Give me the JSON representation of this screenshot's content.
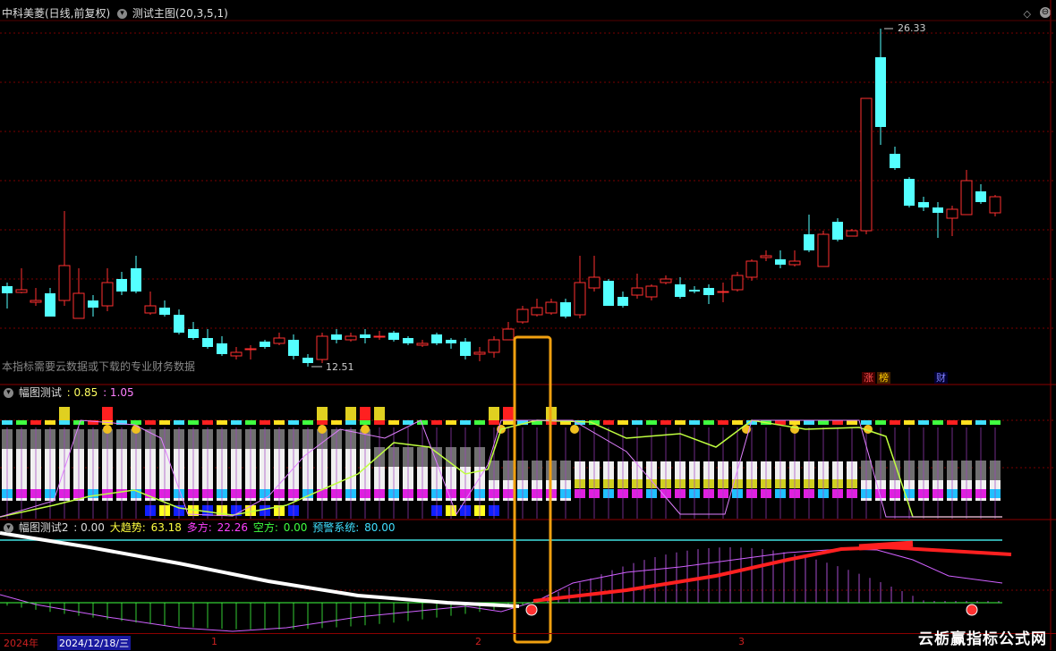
{
  "main_header": {
    "stock": "中科美菱(日线,前复权)",
    "indicator": "测试主图(20,3,5,1)"
  },
  "main_chart": {
    "high_label": "26.33",
    "low_label": "12.51",
    "note": "本指标需要云数据或下载的专业财务数据",
    "badges": {
      "zhang": "涨",
      "bang": "榜",
      "cai": "财"
    }
  },
  "sub1_header": {
    "name": "幅图测试",
    "v1": ": 0.85",
    "v2": ": 1.05"
  },
  "sub2_header": {
    "name": "幅图测试2",
    "v1": ": 0.00",
    "trend_label": "大趋势:",
    "trend_val": "63.18",
    "long_label": "多方:",
    "long_val": "22.26",
    "short_label": "空方:",
    "short_val": "0.00",
    "warn_label": "预警系统:",
    "warn_val": "80.00"
  },
  "x_axis": {
    "year": "2024年",
    "cursor_date": "2024/12/18/三",
    "m1": "1",
    "m2": "2",
    "m3": "3"
  },
  "watermark": "云栃赢指标公式网",
  "colors": {
    "up": "#ff3030",
    "down": "#54ffff",
    "grid": "#8b0000"
  }
}
